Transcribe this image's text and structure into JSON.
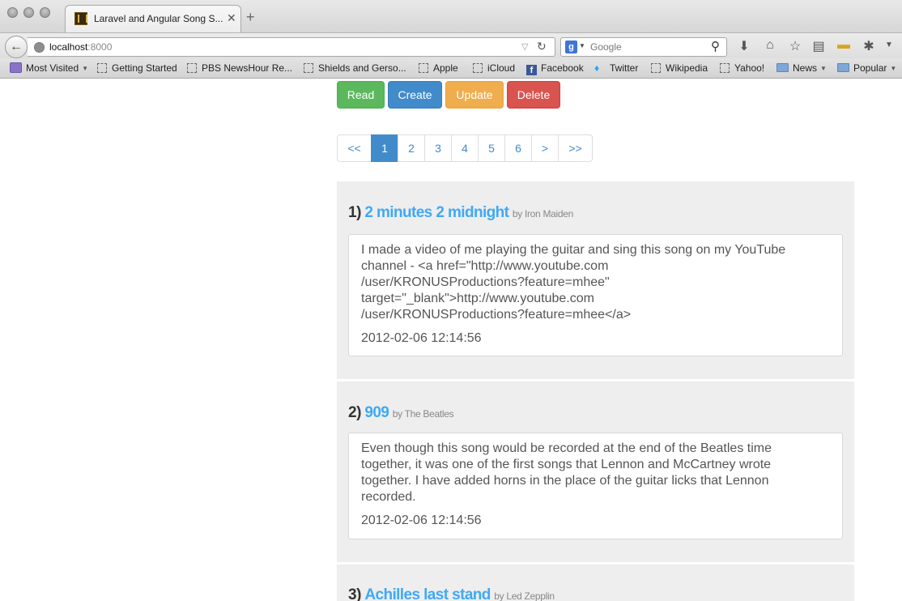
{
  "browser": {
    "tab_title": "Laravel and Angular Song S...",
    "tab_close": "✕",
    "new_tab": "+",
    "url_host": "localhost",
    "url_port": ":8000",
    "search_placeholder": "Google",
    "search_engine_letter": "g",
    "bookmarks": [
      {
        "label": "Most Visited",
        "icon": "most-visited-icon",
        "dropdown": true
      },
      {
        "label": "Getting Started",
        "icon": "page-icon"
      },
      {
        "label": "PBS NewsHour Re...",
        "icon": "page-icon"
      },
      {
        "label": "Shields and Gerso...",
        "icon": "page-icon"
      },
      {
        "label": "Apple",
        "icon": "page-icon"
      },
      {
        "label": "iCloud",
        "icon": "page-icon"
      },
      {
        "label": "Facebook",
        "icon": "facebook-icon"
      },
      {
        "label": "Twitter",
        "icon": "twitter-icon"
      },
      {
        "label": "Wikipedia",
        "icon": "page-icon"
      },
      {
        "label": "Yahoo!",
        "icon": "page-icon"
      },
      {
        "label": "News",
        "icon": "folder-icon",
        "dropdown": true
      },
      {
        "label": "Popular",
        "icon": "folder-icon",
        "dropdown": true
      }
    ]
  },
  "actions": {
    "read": "Read",
    "create": "Create",
    "update": "Update",
    "delete": "Delete"
  },
  "pagination": {
    "first": "<<",
    "prev": ">",
    "pages": [
      "1",
      "2",
      "3",
      "4",
      "5",
      "6"
    ],
    "next": ">",
    "last": ">>",
    "active_page": "1"
  },
  "songs": [
    {
      "number": "1)",
      "title": "2 minutes 2 midnight",
      "by": "by Iron Maiden",
      "description": "I made a video of me playing the guitar and sing this song on my YouTube\nchannel - <a href=\"http://www.youtube.com\n/user/KRONUSProductions?feature=mhee\"\ntarget=\"_blank\">http://www.youtube.com\n/user/KRONUSProductions?feature=mhee</a>",
      "date": "2012-02-06 12:14:56"
    },
    {
      "number": "2)",
      "title": "909",
      "by": "by The Beatles",
      "description": "Even though this song would be recorded at the end of the Beatles time\ntogether, it was one of the first songs that Lennon and McCartney wrote\ntogether. I have added horns in the place of the guitar licks that Lennon\nrecorded.",
      "date": "2012-02-06 12:14:56"
    },
    {
      "number": "3)",
      "title": "Achilles last stand",
      "by": "by Led Zepplin"
    }
  ]
}
